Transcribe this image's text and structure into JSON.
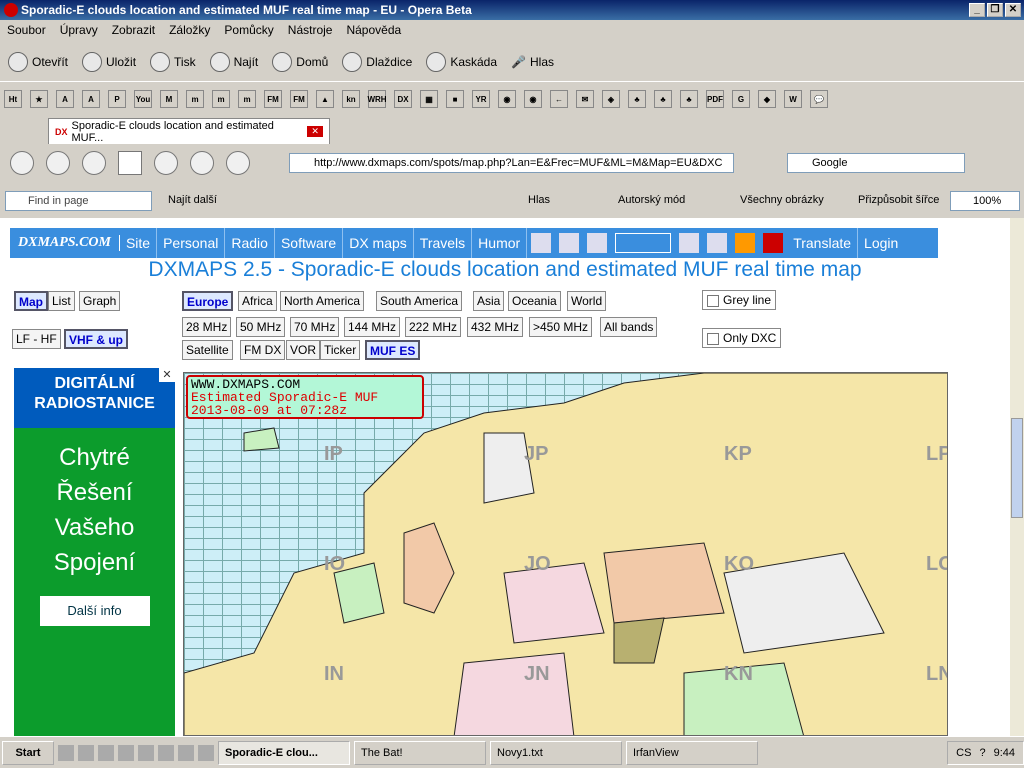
{
  "window": {
    "title": "Sporadic-E clouds location and estimated MUF real time map - EU - Opera Beta"
  },
  "menu": [
    "Soubor",
    "Úpravy",
    "Zobrazit",
    "Záložky",
    "Pomůcky",
    "Nástroje",
    "Nápověda"
  ],
  "toolbar": {
    "open": "Otevřít",
    "save": "Uložit",
    "print": "Tisk",
    "find": "Najít",
    "home": "Domů",
    "tile": "Dlaždice",
    "cascade": "Kaskáda",
    "voice": "Hlas"
  },
  "bookmarks": [
    "Ht",
    "★",
    "A",
    "A",
    "P",
    "You",
    "M",
    "m",
    "m",
    "m",
    "FM",
    "FM",
    "▲",
    "kn",
    "WRH",
    "DX",
    "▦",
    "■",
    "YR",
    "◉",
    "◉",
    "←",
    "✉",
    "◈",
    "♣",
    "♣",
    "♣",
    "PDF",
    "G",
    "◆",
    "W",
    "💬"
  ],
  "tab": {
    "label": "Sporadic-E clouds location and estimated MUF...",
    "close": "✕"
  },
  "address": {
    "url": "http://www.dxmaps.com/spots/map.php?Lan=E&Frec=MUF&ML=M&Map=EU&DXC"
  },
  "search": {
    "engine": "Google"
  },
  "findbar": {
    "placeholder": "Find in page",
    "next": "Najít další",
    "voice": "Hlas",
    "author_mode": "Autorský mód",
    "images": "Všechny obrázky",
    "fit": "Přizpůsobit šířce",
    "zoom": "100%"
  },
  "site": {
    "logo": "DXMAPS.COM",
    "nav": [
      "Site",
      "Personal",
      "Radio",
      "Software",
      "DX maps",
      "Travels",
      "Humor"
    ],
    "translate": "Translate",
    "login": "Login",
    "headline": "DXMAPS 2.5 - Sporadic-E clouds location and estimated MUF real time map"
  },
  "view": [
    "Map",
    "List",
    "Graph"
  ],
  "range": [
    "LF - HF",
    "VHF & up"
  ],
  "regions": [
    "Europe",
    "Africa",
    "North America",
    "South America",
    "Asia",
    "Oceania",
    "World"
  ],
  "bands": [
    "28 MHz",
    "50 MHz",
    "70 MHz",
    "144 MHz",
    "222 MHz",
    "432 MHz",
    ">450 MHz",
    "All bands"
  ],
  "modes": [
    "Satellite",
    "FM DX",
    "VOR",
    "Ticker",
    "MUF ES"
  ],
  "options": {
    "grey": "Grey line",
    "dxc": "Only DXC"
  },
  "ad": {
    "top": "DIGITÁLNÍ RADIOSTANICE",
    "body1": "Chytré",
    "body2": "Řešení",
    "body3": "Vašeho",
    "body4": "Spojení",
    "button": "Další info",
    "close": "✕"
  },
  "map": {
    "site": "WWW.DXMAPS.COM",
    "label": "Estimated Sporadic-E MUF",
    "date": "2013-08-09 at 07:28z",
    "grid": [
      "IP",
      "JP",
      "KP",
      "LP",
      "IO",
      "JO",
      "KO",
      "LO",
      "IN",
      "JN",
      "KN",
      "LN"
    ]
  },
  "taskbar": {
    "start": "Start",
    "tasks": [
      "Sporadic-E clou...",
      "The Bat!",
      "Novy1.txt",
      "IrfanView"
    ],
    "lang": "CS",
    "help": "?",
    "time": "9:44"
  }
}
